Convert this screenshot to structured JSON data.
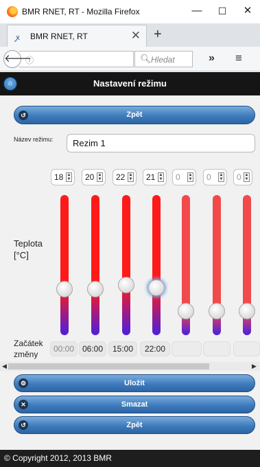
{
  "window": {
    "title": "BMR RNET, RT - Mozilla Firefox",
    "minimize": "—",
    "maximize": "☐",
    "close": "✕"
  },
  "tab": {
    "title": "BMR RNET, RT",
    "favicon": "ꭙ",
    "close": "✕",
    "new_tab": "+"
  },
  "nav": {
    "back": "🡐",
    "info": "ⓘ",
    "reload": "C",
    "search_placeholder": "Hledat",
    "overflow": "»",
    "menu": "≡"
  },
  "page": {
    "title": "Nastavení režimu",
    "home_icon": "home-icon"
  },
  "buttons": {
    "back_top": "Zpět",
    "save": "Uložit",
    "delete": "Smazat",
    "back_bottom": "Zpět"
  },
  "form": {
    "name_label": "Název režimu:",
    "name_value": "Rezim  1"
  },
  "temperature_label_line1": "Teplota",
  "temperature_label_line2": "[°C]",
  "temperatures": [
    "18",
    "20",
    "22",
    "21",
    "0",
    "0",
    "0"
  ],
  "slider_levels": [
    0.33,
    0.33,
    0.36,
    0.34,
    0.17,
    0.17,
    0.17
  ],
  "start_label_line1": "Začátek",
  "start_label_line2": "změny",
  "start_times": [
    "00:00",
    "06:00",
    "15:00",
    "22:00",
    "",
    "",
    ""
  ],
  "footer": "© Copyright 2012, 2013 BMR",
  "colors": {
    "track_top": "#ff1a1a",
    "track_bottom": "#4a1ee0",
    "button": "#3e7bbd",
    "header": "#151515"
  }
}
